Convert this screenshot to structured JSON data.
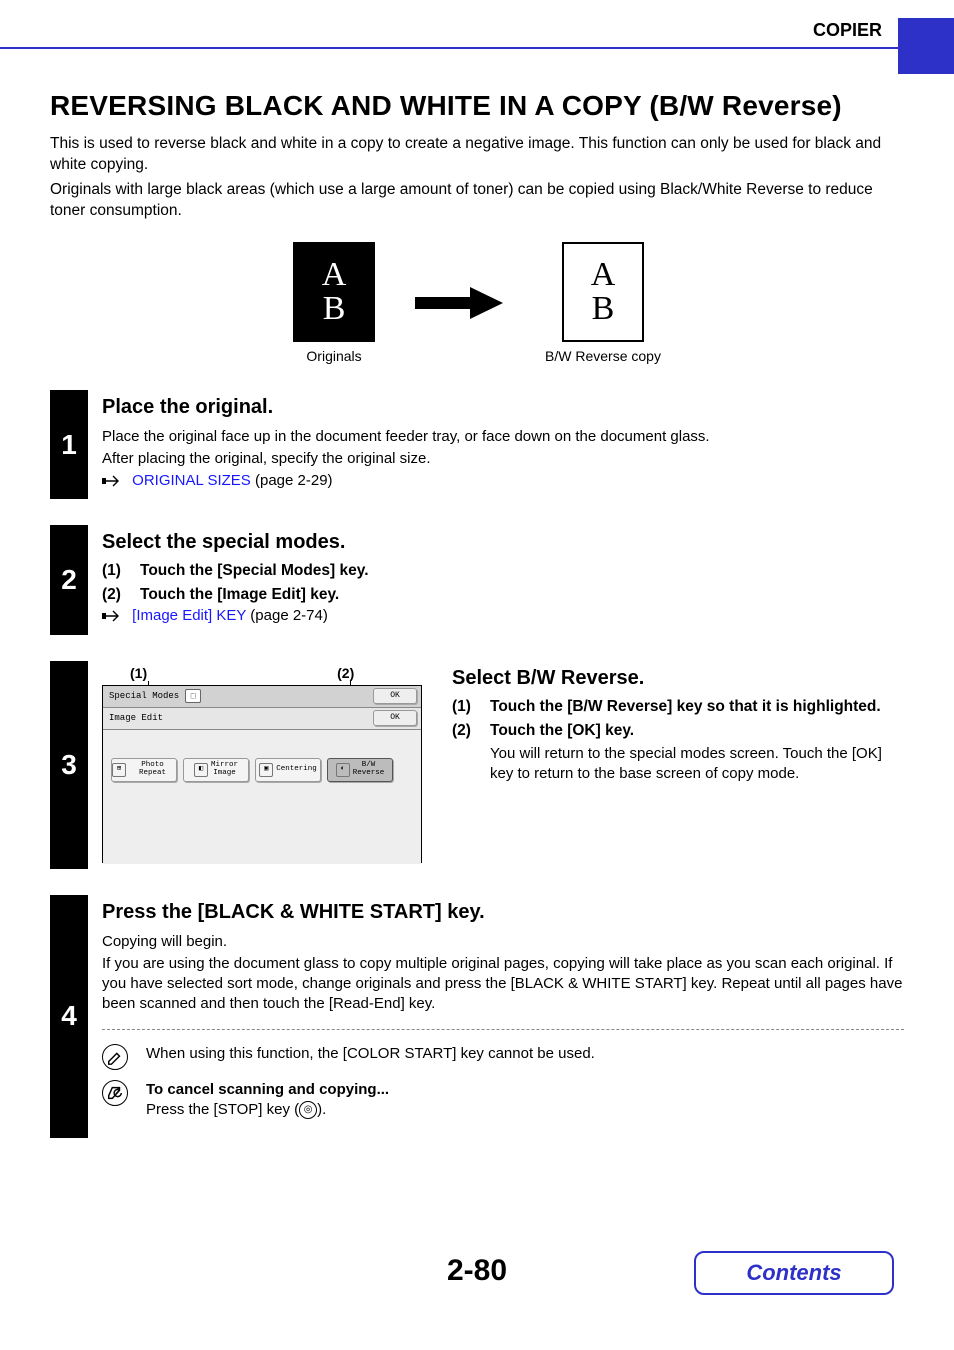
{
  "header": {
    "section": "COPIER"
  },
  "title": "REVERSING BLACK AND WHITE IN A COPY (B/W Reverse)",
  "intro": [
    "This is used to reverse black and white in a copy to create a negative image. This function can only be used for black and white copying.",
    "Originals with large black areas (which use a large amount of toner) can be copied using Black/White Reverse to reduce toner consumption."
  ],
  "illus": {
    "letter_a": "A",
    "letter_b": "B",
    "cap_left": "Originals",
    "cap_right": "B/W Reverse copy"
  },
  "steps": [
    {
      "num": "1",
      "heading": "Place the original.",
      "lines": [
        "Place the original face up in the document feeder tray, or face down on the document glass.",
        "After placing the original, specify the original size."
      ],
      "link": {
        "text": "ORIGINAL SIZES",
        "page": " (page 2-29)"
      }
    },
    {
      "num": "2",
      "heading": "Select the special modes.",
      "subs": [
        {
          "n": "(1)",
          "t": "Touch the [Special Modes] key."
        },
        {
          "n": "(2)",
          "t": "Touch the [Image Edit] key."
        }
      ],
      "link": {
        "text": "[Image Edit] KEY",
        "page": " (page 2-74)"
      }
    },
    {
      "num": "3",
      "heading_right": "Select B/W Reverse.",
      "subs": [
        {
          "n": "(1)",
          "t": "Touch the [B/W Reverse] key so that it is highlighted."
        },
        {
          "n": "(2)",
          "t": "Touch the [OK] key."
        }
      ],
      "detail": "You will return to the special modes screen. Touch the [OK] key to return to the base screen of copy mode.",
      "callouts": {
        "c1": "(1)",
        "c2": "(2)"
      },
      "panel": {
        "tab1": "Special Modes",
        "tab2": "Image Edit",
        "ok": "OK",
        "btn_photo": "Photo Repeat",
        "btn_mirror": "Mirror\nImage",
        "btn_center": "Centering",
        "btn_bw": "B/W\nReverse"
      }
    },
    {
      "num": "4",
      "heading": "Press the [BLACK & WHITE START] key.",
      "lines": [
        "Copying will begin.",
        "If you are using the document glass to copy multiple original pages, copying will take place as you scan each original. If you have selected sort mode, change originals and press the [BLACK & WHITE START] key. Repeat until all pages have been scanned and then touch the [Read-End] key."
      ],
      "note1": "When using this function, the [COLOR START] key cannot be used.",
      "note2_title": "To cancel scanning and copying...",
      "note2_body_a": "Press the [STOP] key (",
      "note2_body_b": ")."
    }
  ],
  "page_number": "2-80",
  "contents_label": "Contents"
}
